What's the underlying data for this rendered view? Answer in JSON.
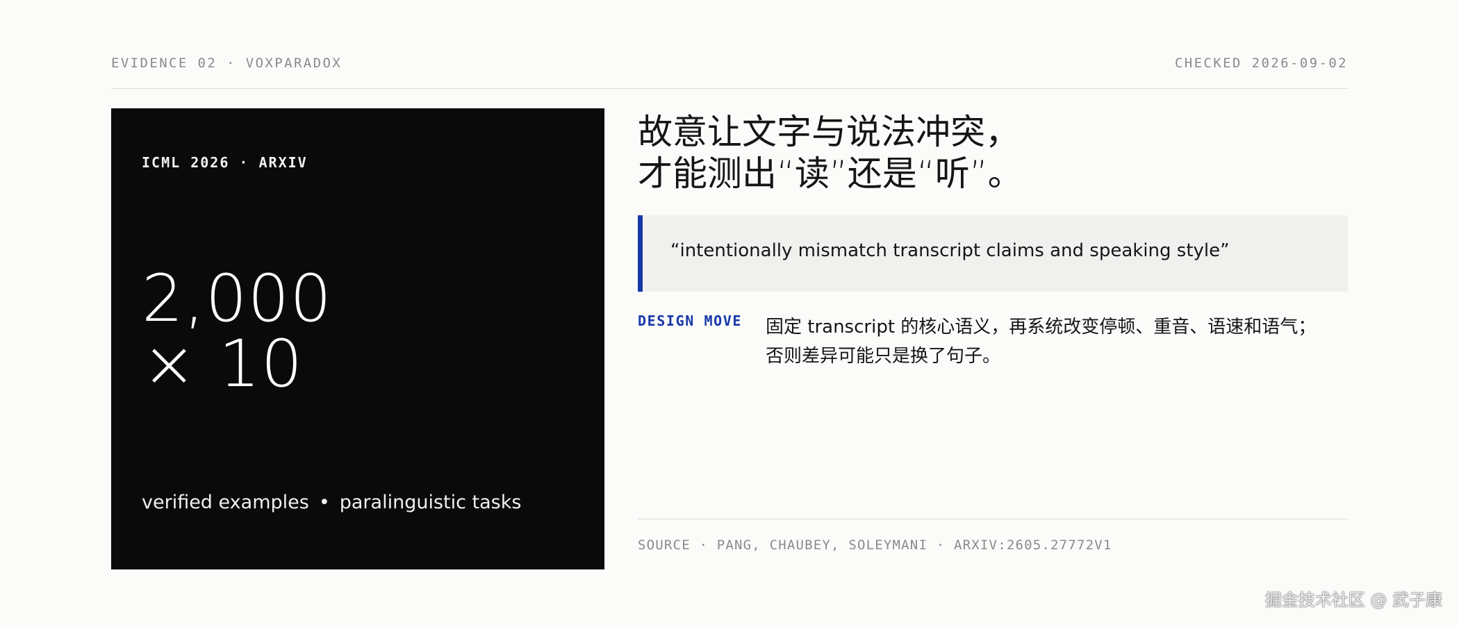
{
  "header": {
    "left": "EVIDENCE 02 · VOXPARADOX",
    "right": "CHECKED 2026-09-02"
  },
  "card": {
    "venue": "ICML 2026 · ARXIV",
    "stat_line1": "2,000",
    "stat_line2": "× 10",
    "footer_left": "verified examples",
    "footer_sep": "•",
    "footer_right": "paralinguistic tasks"
  },
  "headline": {
    "line1": "故意让文字与说法冲突，",
    "line2": "才能测出“读”还是“听”。"
  },
  "quote": {
    "text": "“intentionally mismatch transcript claims and speaking style”",
    "accent_color": "#1738a8"
  },
  "design_move": {
    "label": "DESIGN MOVE",
    "text": "固定 transcript 的核心语义，再系统改变停顿、重音、语速和语气；否则差异可能只是换了句子。"
  },
  "source": {
    "text": "SOURCE · PANG, CHAUBEY, SOLEYMANI · ARXIV:2605.27772V1"
  },
  "watermark": {
    "text": "掘金技术社区 @ 武子康"
  }
}
